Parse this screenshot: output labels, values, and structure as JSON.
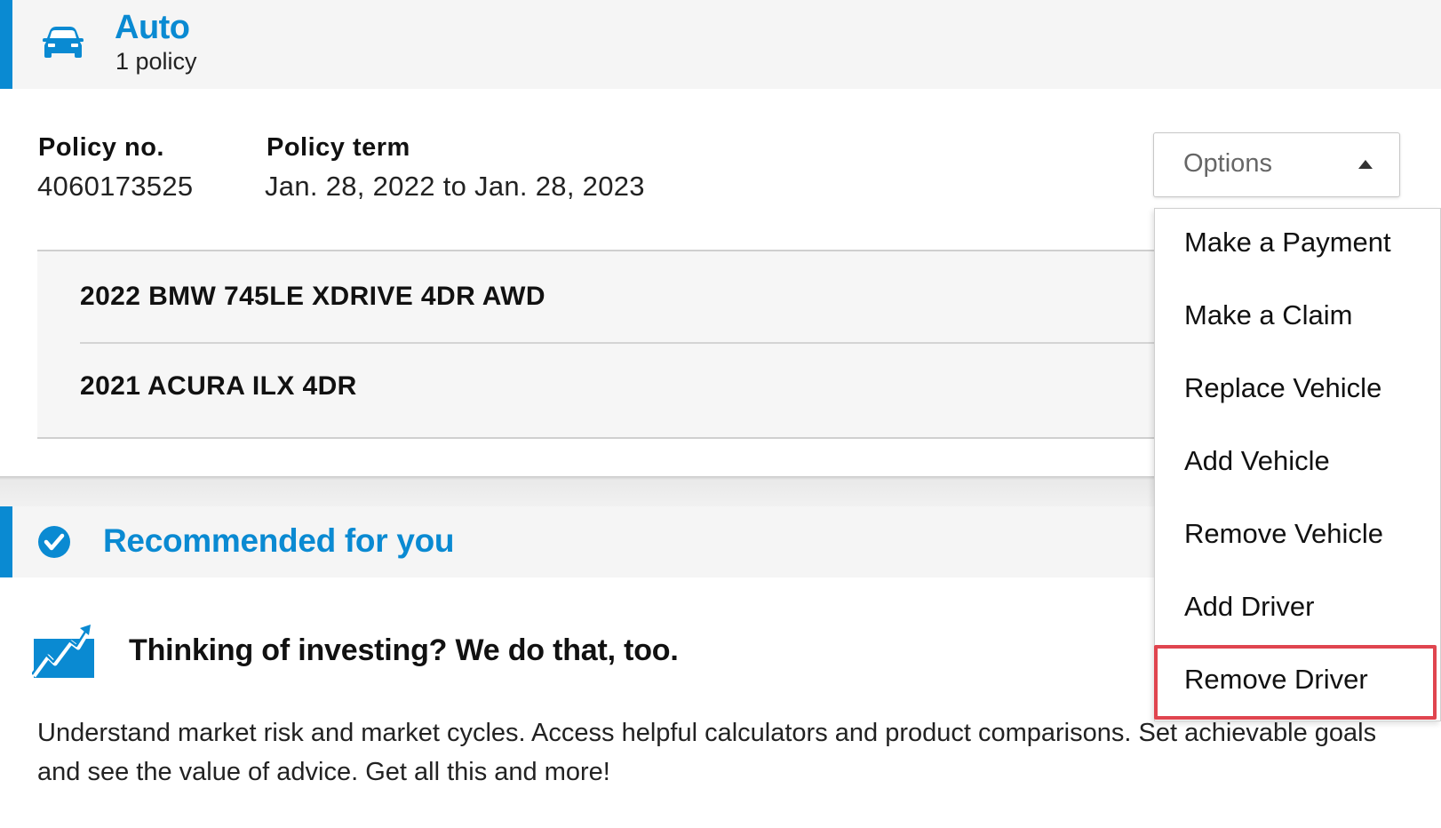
{
  "auto_section": {
    "title": "Auto",
    "subtitle": "1 policy",
    "icon": "car-icon"
  },
  "policy": {
    "number_label": "Policy no.",
    "number_value": "4060173525",
    "term_label": "Policy term",
    "term_value": "Jan. 28, 2022 to Jan. 28, 2023"
  },
  "vehicles": [
    "2022 BMW 745LE XDRIVE 4DR AWD",
    "2021 ACURA ILX 4DR"
  ],
  "recommended": {
    "title": "Recommended for you",
    "icon": "check-circle-icon",
    "card_title": "Thinking of investing? We do that, too.",
    "card_icon": "chart-growth-icon",
    "card_body": "Understand market risk and market cycles. Access helpful calculators and product comparisons. Set achievable goals and see the value of advice. Get all this and more!"
  },
  "options": {
    "label": "Options",
    "expanded": true,
    "items": [
      "Make a Payment",
      "Make a Claim",
      "Replace Vehicle",
      "Add Vehicle",
      "Remove Vehicle",
      "Add Driver",
      "Remove Driver"
    ],
    "highlighted_item": "Remove Driver"
  },
  "colors": {
    "accent": "#0a8ad2",
    "highlight": "#e0454f",
    "header_bg": "#f5f5f5"
  }
}
